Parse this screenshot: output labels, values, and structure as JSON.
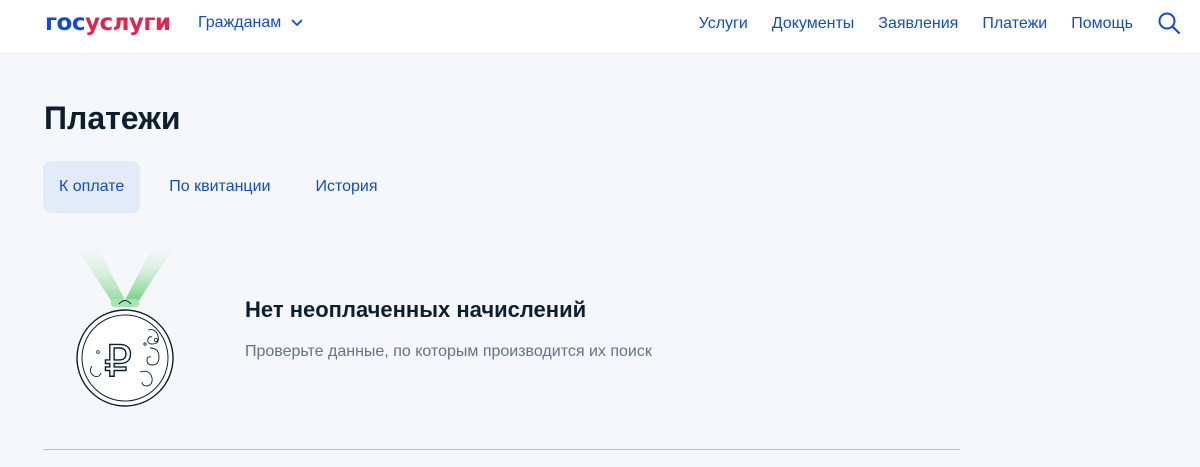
{
  "header": {
    "logo_part1": "гос",
    "logo_part2": "услуги",
    "audience_label": "Гражданам",
    "nav": [
      {
        "label": "Услуги"
      },
      {
        "label": "Документы"
      },
      {
        "label": "Заявления"
      },
      {
        "label": "Платежи"
      },
      {
        "label": "Помощь"
      }
    ]
  },
  "page": {
    "title": "Платежи",
    "tabs": [
      {
        "label": "К оплате",
        "active": true
      },
      {
        "label": "По квитанции",
        "active": false
      },
      {
        "label": "История",
        "active": false
      }
    ]
  },
  "empty_state": {
    "title": "Нет неоплаченных начислений",
    "text": "Проверьте данные, по которым производится их поиск",
    "medal_symbol": "₽"
  },
  "colors": {
    "brand_blue": "#0d4cd3",
    "brand_red": "#e4234f",
    "active_tab_bg": "#e3ebf9",
    "page_bg": "#f5f7fa",
    "ribbon_green": "#7ed68a"
  }
}
